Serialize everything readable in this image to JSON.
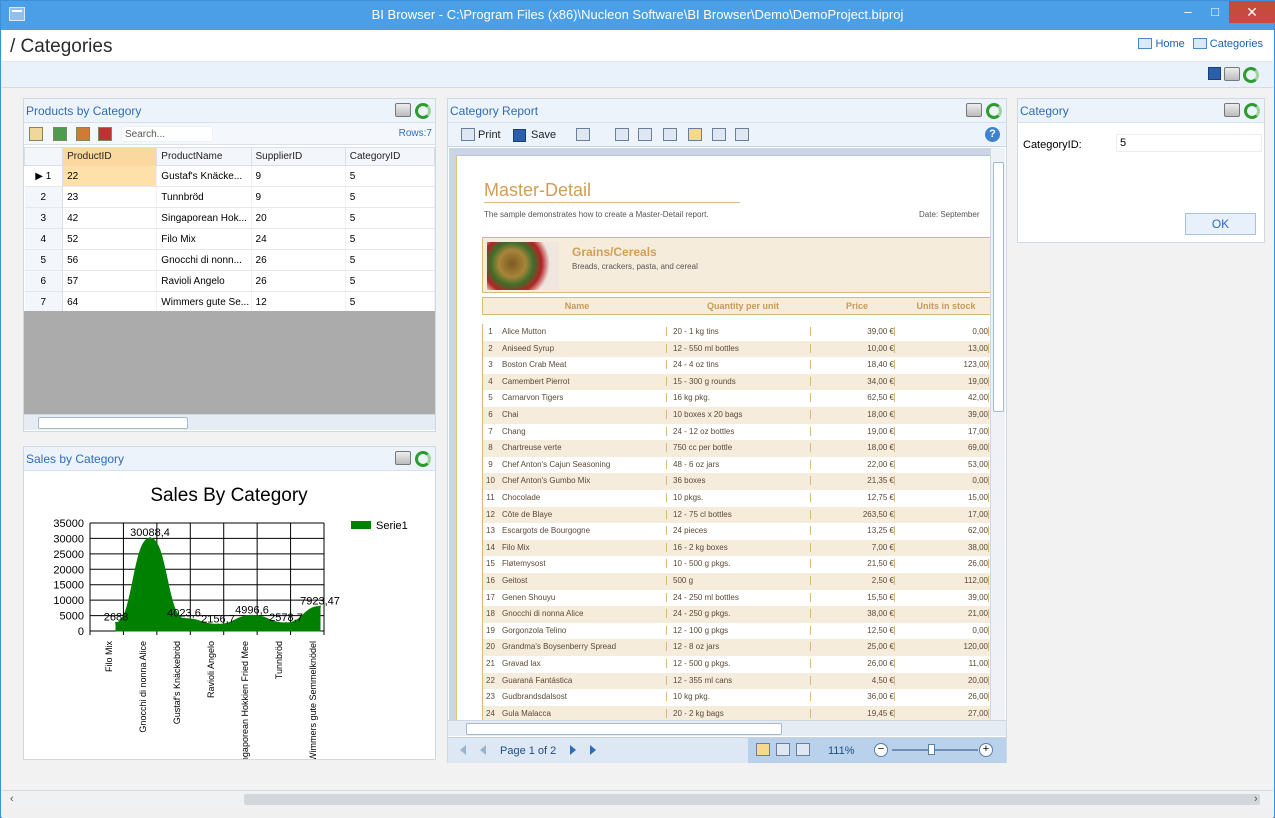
{
  "window": {
    "title": "BI Browser - C:\\Program Files (x86)\\Nucleon Software\\BI Browser\\Demo\\DemoProject.biproj",
    "minimize": "–",
    "maximize": "□",
    "close": "✕"
  },
  "nav": {
    "breadcrumb": "/ Categories",
    "links": [
      {
        "label": "Home",
        "icon": "grid-icon"
      },
      {
        "label": "Categories",
        "icon": "grid-icon"
      }
    ]
  },
  "products_panel": {
    "title": "Products by Category",
    "search_placeholder": "Search...",
    "rows_label": "Rows:7",
    "columns": [
      "ProductID",
      "ProductName",
      "SupplierID",
      "CategoryID"
    ],
    "rows": [
      {
        "n": "1",
        "marker": "▶",
        "id": "22",
        "name": "Gustaf's Knäcke...",
        "supplier": "9",
        "category": "5"
      },
      {
        "n": "2",
        "marker": "",
        "id": "23",
        "name": "Tunnbröd",
        "supplier": "9",
        "category": "5"
      },
      {
        "n": "3",
        "marker": "",
        "id": "42",
        "name": "Singaporean Hok...",
        "supplier": "20",
        "category": "5"
      },
      {
        "n": "4",
        "marker": "",
        "id": "52",
        "name": "Filo Mix",
        "supplier": "24",
        "category": "5"
      },
      {
        "n": "5",
        "marker": "",
        "id": "56",
        "name": "Gnocchi di nonn...",
        "supplier": "26",
        "category": "5"
      },
      {
        "n": "6",
        "marker": "",
        "id": "57",
        "name": "Ravioli Angelo",
        "supplier": "26",
        "category": "5"
      },
      {
        "n": "7",
        "marker": "",
        "id": "64",
        "name": "Wimmers gute Se...",
        "supplier": "12",
        "category": "5"
      }
    ]
  },
  "sales_panel": {
    "title": "Sales by Category"
  },
  "chart_data": {
    "type": "area",
    "title": "Sales By Category",
    "categories": [
      "Filo Mix",
      "Gnocchi di nonna Alice",
      "Gustaf's Knäckebröd",
      "Ravioli Angelo",
      "Singaporean Hokkien Fried Mee",
      "Tunnbröd",
      "Wimmers gute Semmelknödel"
    ],
    "series": [
      {
        "name": "Serie1",
        "values": [
          2688,
          30088.4,
          4023.6,
          2156.7,
          4996.6,
          2578.7,
          7923.47
        ]
      }
    ],
    "data_labels": [
      "2688",
      "30088,4",
      "4023,6",
      "2156,7",
      "4996,6",
      "2578,7",
      "7923,47"
    ],
    "yticks": [
      "35000",
      "30000",
      "25000",
      "20000",
      "15000",
      "10000",
      "5000",
      "0"
    ],
    "ylim": [
      0,
      35000
    ],
    "grid": true,
    "legend": "top-right",
    "color": "#008000"
  },
  "report_panel": {
    "title": "Category Report",
    "toolbar": {
      "print": "Print",
      "save": "Save"
    },
    "report_title": "Master-Detail",
    "description": "The sample demonstrates how to create a Master-Detail report.",
    "date_label": "Date: September",
    "category_name": "Grains/Cereals",
    "category_desc": "Breads, crackers, pasta, and cereal",
    "columns": [
      "Name",
      "Quantity per unit",
      "Price",
      "Units in stock"
    ],
    "rows": [
      [
        "1",
        "Alice Mutton",
        "20 - 1 kg tins",
        "39,00 €",
        "0,00"
      ],
      [
        "2",
        "Aniseed Syrup",
        "12 - 550 ml bottles",
        "10,00 €",
        "13,00"
      ],
      [
        "3",
        "Boston Crab Meat",
        "24 - 4 oz tins",
        "18,40 €",
        "123,00"
      ],
      [
        "4",
        "Camembert Pierrot",
        "15 - 300 g rounds",
        "34,00 €",
        "19,00"
      ],
      [
        "5",
        "Carnarvon Tigers",
        "16 kg pkg.",
        "62,50 €",
        "42,00"
      ],
      [
        "6",
        "Chai",
        "10 boxes x 20 bags",
        "18,00 €",
        "39,00"
      ],
      [
        "7",
        "Chang",
        "24 - 12 oz bottles",
        "19,00 €",
        "17,00"
      ],
      [
        "8",
        "Chartreuse verte",
        "750 cc per bottle",
        "18,00 €",
        "69,00"
      ],
      [
        "9",
        "Chef Anton's Cajun Seasoning",
        "48 - 6 oz jars",
        "22,00 €",
        "53,00"
      ],
      [
        "10",
        "Chef Anton's Gumbo Mix",
        "36 boxes",
        "21,35 €",
        "0,00"
      ],
      [
        "11",
        "Chocolade",
        "10 pkgs.",
        "12,75 €",
        "15,00"
      ],
      [
        "12",
        "Côte de Blaye",
        "12 - 75 cl bottles",
        "263,50 €",
        "17,00"
      ],
      [
        "13",
        "Escargots de Bourgogne",
        "24 pieces",
        "13,25 €",
        "62,00"
      ],
      [
        "14",
        "Filo Mix",
        "16 - 2 kg boxes",
        "7,00 €",
        "38,00"
      ],
      [
        "15",
        "Fløtemysost",
        "10 - 500 g pkgs.",
        "21,50 €",
        "26,00"
      ],
      [
        "16",
        "Geitost",
        "500 g",
        "2,50 €",
        "112,00"
      ],
      [
        "17",
        "Genen Shouyu",
        "24 - 250 ml bottles",
        "15,50 €",
        "39,00"
      ],
      [
        "18",
        "Gnocchi di nonna Alice",
        "24 - 250 g pkgs.",
        "38,00 €",
        "21,00"
      ],
      [
        "19",
        "Gorgonzola Telino",
        "12 - 100 g pkgs",
        "12,50 €",
        "0,00"
      ],
      [
        "20",
        "Grandma's Boysenberry Spread",
        "12 - 8 oz jars",
        "25,00 €",
        "120,00"
      ],
      [
        "21",
        "Gravad lax",
        "12 - 500 g pkgs.",
        "26,00 €",
        "11,00"
      ],
      [
        "22",
        "Guaraná Fantástica",
        "12 - 355 ml cans",
        "4,50 €",
        "20,00"
      ],
      [
        "23",
        "Gudbrandsdalsost",
        "10 kg pkg.",
        "36,00 €",
        "26,00"
      ],
      [
        "24",
        "Gula Malacca",
        "20 - 2 kg bags",
        "19,45 €",
        "27,00"
      ]
    ],
    "page_label": "Page 1 of 2",
    "zoom": "111%"
  },
  "category_panel": {
    "title": "Category",
    "field_label": "CategoryID:",
    "field_value": "5",
    "ok": "OK"
  }
}
